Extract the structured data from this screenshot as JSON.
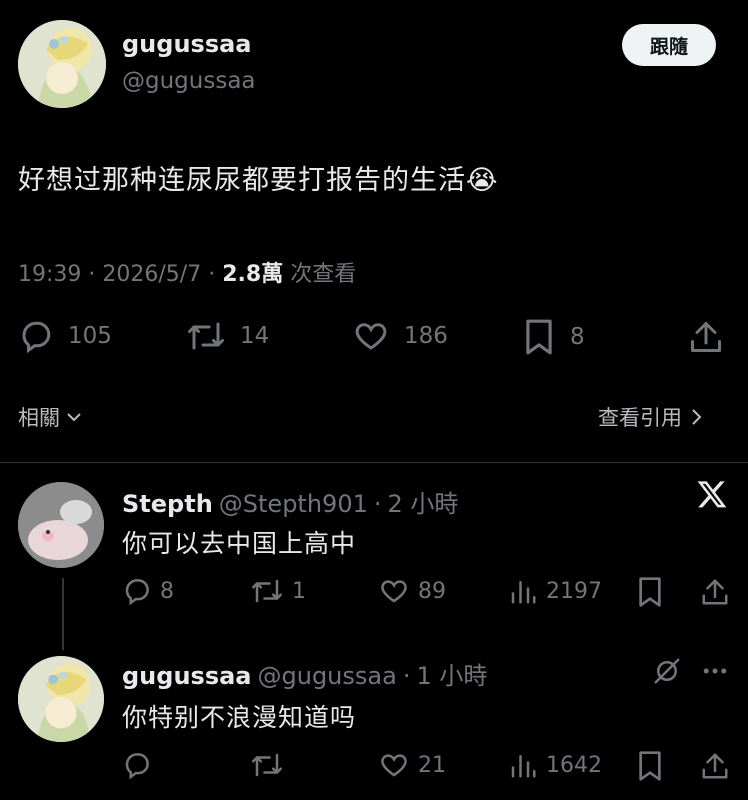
{
  "main_tweet": {
    "display_name": "gugussaa",
    "handle": "@gugussaa",
    "follow_label": "跟隨",
    "text": "好想过那种连尿尿都要打报告的生活",
    "emoji": "😭",
    "time": "19:39",
    "date": "2026/5/7",
    "views_count": "2.8萬",
    "views_label": "次查看",
    "replies": "105",
    "retweets": "14",
    "likes": "186",
    "bookmarks": "8"
  },
  "related_label": "相關",
  "view_quotes_label": "查看引用",
  "replies": [
    {
      "display_name": "Stepth",
      "handle": "@Stepth901",
      "time": "2 小時",
      "text": "你可以去中国上高中",
      "replies": "8",
      "retweets": "1",
      "likes": "89",
      "views": "2197",
      "corner_icon": "x-logo-icon"
    },
    {
      "display_name": "gugussaa",
      "handle": "@gugussaa",
      "time": "1 小時",
      "text": "你特别不浪漫知道吗",
      "replies": "",
      "retweets": "",
      "likes": "21",
      "views": "1642",
      "corner_icon": "grok-icon"
    }
  ],
  "colors": {
    "background": "#000000",
    "text": "#e7e9ea",
    "secondary": "#71767b",
    "divider": "#2f3336",
    "button_bg": "#eff3f4"
  }
}
